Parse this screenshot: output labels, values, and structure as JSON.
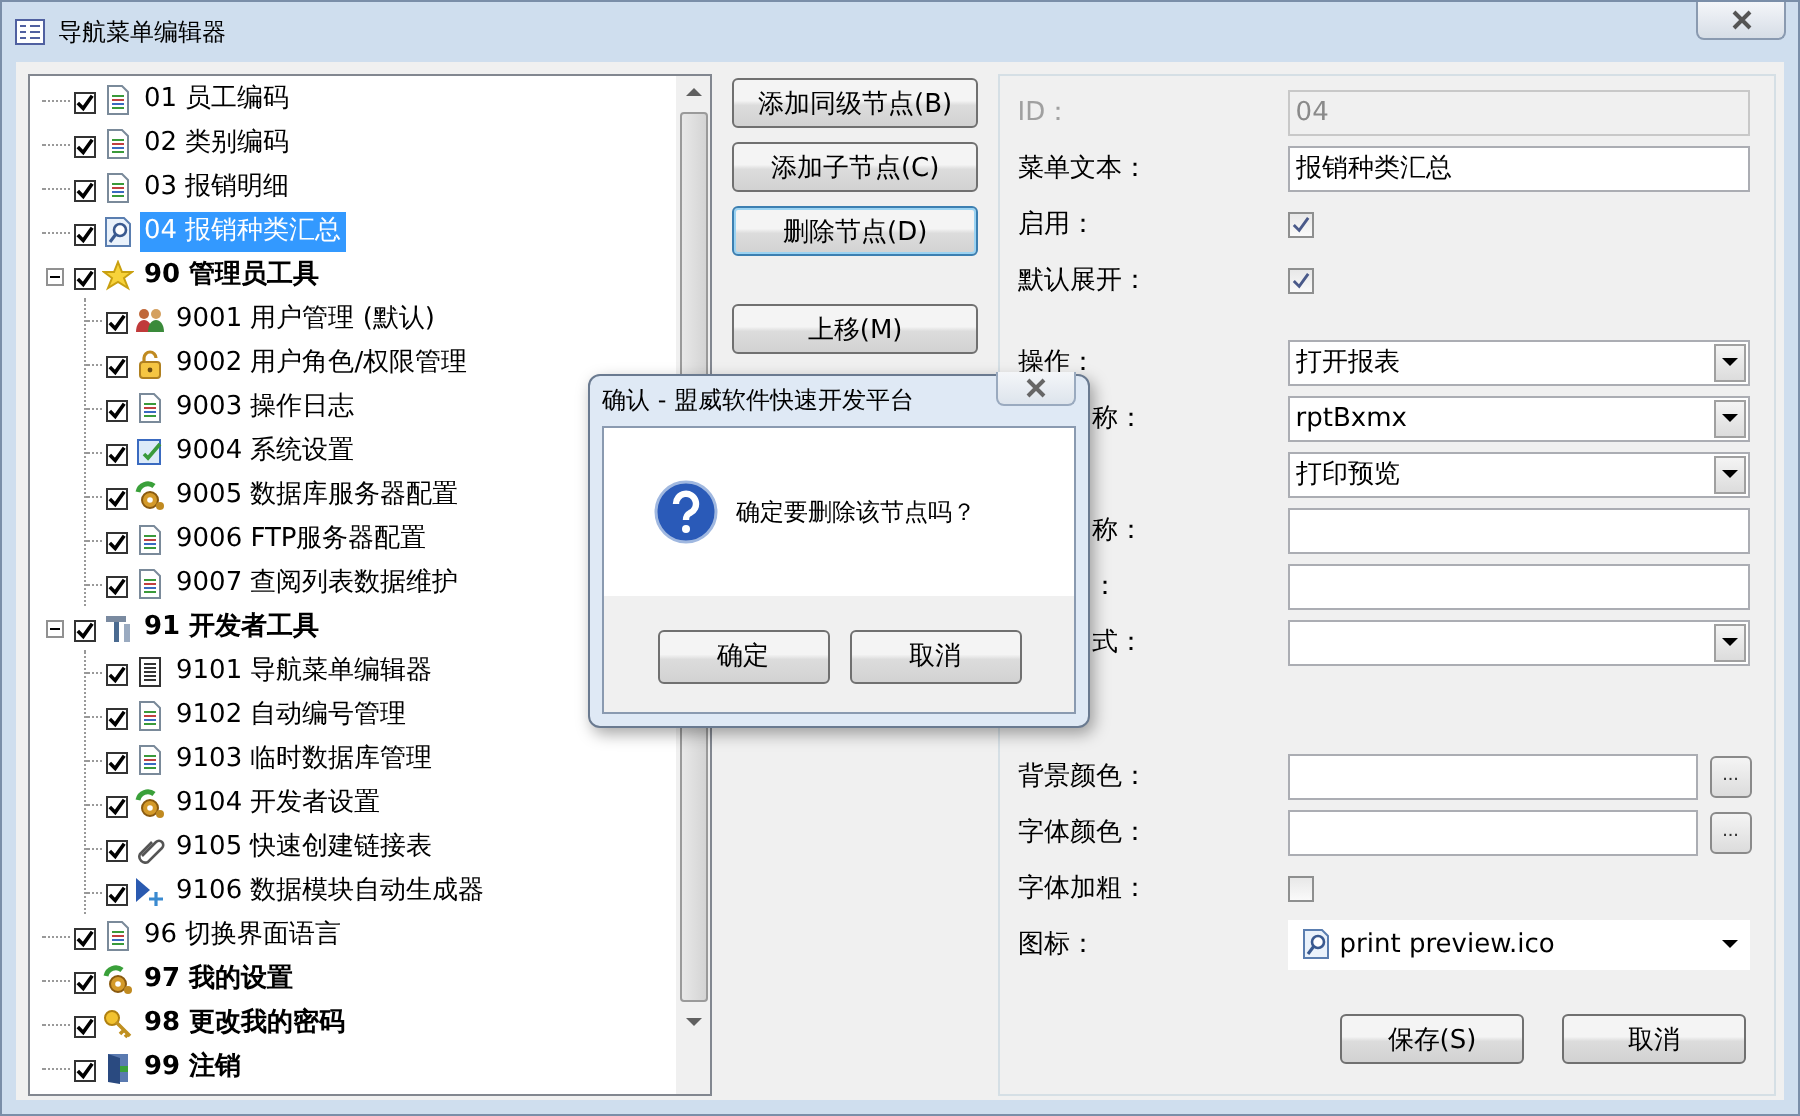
{
  "window": {
    "title": "导航菜单编辑器"
  },
  "tree": {
    "items": [
      {
        "label": "01 员工编码",
        "kind": "report",
        "checked": true,
        "selected": false,
        "bold": false
      },
      {
        "label": "02 类别编码",
        "kind": "report",
        "checked": true,
        "selected": false,
        "bold": false
      },
      {
        "label": "03 报销明细",
        "kind": "report",
        "checked": true,
        "selected": false,
        "bold": false
      },
      {
        "label": "04 报销种类汇总",
        "kind": "preview",
        "checked": true,
        "selected": true,
        "bold": false
      },
      {
        "label": "90 管理员工具",
        "kind": "star",
        "checked": true,
        "selected": false,
        "bold": true,
        "expanded": true,
        "children": [
          {
            "label": "9001 用户管理 (默认)",
            "kind": "users",
            "checked": true,
            "selected": false,
            "bold": false
          },
          {
            "label": "9002 用户角色/权限管理",
            "kind": "lock",
            "checked": true,
            "selected": false,
            "bold": false
          },
          {
            "label": "9003 操作日志",
            "kind": "report",
            "checked": true,
            "selected": false,
            "bold": false
          },
          {
            "label": "9004 系统设置",
            "kind": "settings",
            "checked": true,
            "selected": false,
            "bold": false
          },
          {
            "label": "9005 数据库服务器配置",
            "kind": "gears",
            "checked": true,
            "selected": false,
            "bold": false
          },
          {
            "label": "9006 FTP服务器配置",
            "kind": "report",
            "checked": true,
            "selected": false,
            "bold": false
          },
          {
            "label": "9007 查阅列表数据维护",
            "kind": "report",
            "checked": true,
            "selected": false,
            "bold": false
          }
        ]
      },
      {
        "label": "91 开发者工具",
        "kind": "tools",
        "checked": true,
        "selected": false,
        "bold": true,
        "expanded": true,
        "children": [
          {
            "label": "9101 导航菜单编辑器",
            "kind": "list",
            "checked": true,
            "selected": false,
            "bold": false
          },
          {
            "label": "9102 自动编号管理",
            "kind": "report",
            "checked": true,
            "selected": false,
            "bold": false
          },
          {
            "label": "9103 临时数据库管理",
            "kind": "report",
            "checked": true,
            "selected": false,
            "bold": false
          },
          {
            "label": "9104 开发者设置",
            "kind": "gears",
            "checked": true,
            "selected": false,
            "bold": false
          },
          {
            "label": "9105 快速创建链接表",
            "kind": "link",
            "checked": true,
            "selected": false,
            "bold": false
          },
          {
            "label": "9106 数据模块自动生成器",
            "kind": "arrow",
            "checked": true,
            "selected": false,
            "bold": false
          }
        ]
      },
      {
        "label": "96 切换界面语言",
        "kind": "report",
        "checked": true,
        "selected": false,
        "bold": false
      },
      {
        "label": "97 我的设置",
        "kind": "gears",
        "checked": true,
        "selected": false,
        "bold": true
      },
      {
        "label": "98 更改我的密码",
        "kind": "key",
        "checked": true,
        "selected": false,
        "bold": true
      },
      {
        "label": "99 注销",
        "kind": "door",
        "checked": true,
        "selected": false,
        "bold": true
      }
    ]
  },
  "button_groups": [
    [
      {
        "label": "添加同级节点(B)",
        "focused": false
      },
      {
        "label": "添加子节点(C)",
        "focused": false
      },
      {
        "label": "删除节点(D)",
        "focused": true
      }
    ],
    [
      {
        "label": "上移(M)",
        "focused": false
      }
    ]
  ],
  "form": {
    "groups": [
      [
        {
          "kind": "text",
          "label": "ID：",
          "value": "04",
          "disabled": true
        },
        {
          "kind": "text",
          "label": "菜单文本：",
          "value": "报销种类汇总",
          "disabled": false
        },
        {
          "kind": "check",
          "label": "启用：",
          "checked": true
        },
        {
          "kind": "check",
          "label": "默认展开：",
          "checked": true
        }
      ],
      [
        {
          "kind": "select",
          "label": "操作：",
          "value": "打开报表"
        },
        {
          "kind": "select",
          "label": "称：",
          "value": "rptBxmx"
        },
        {
          "kind": "select",
          "value": "打印预览"
        },
        {
          "kind": "text",
          "label": "称：",
          "disabled": false
        },
        {
          "kind": "text",
          "label": "：",
          "disabled": false
        },
        {
          "kind": "select",
          "label": "式："
        }
      ],
      [
        {
          "kind": "color",
          "label": "背景颜色：",
          "button": "..."
        },
        {
          "kind": "color",
          "label": "字体颜色：",
          "button": "..."
        },
        {
          "kind": "check",
          "label": "字体加粗：",
          "checked": false
        },
        {
          "kind": "icon-select",
          "label": "图标：",
          "value": "print preview.ico"
        }
      ]
    ],
    "actions": [
      "保存(S)",
      "取消"
    ]
  },
  "dialog": {
    "title": "确认 - 盟威软件快速开发平台",
    "message": "确定要删除该节点吗？",
    "buttons": [
      "确定",
      "取消"
    ]
  }
}
